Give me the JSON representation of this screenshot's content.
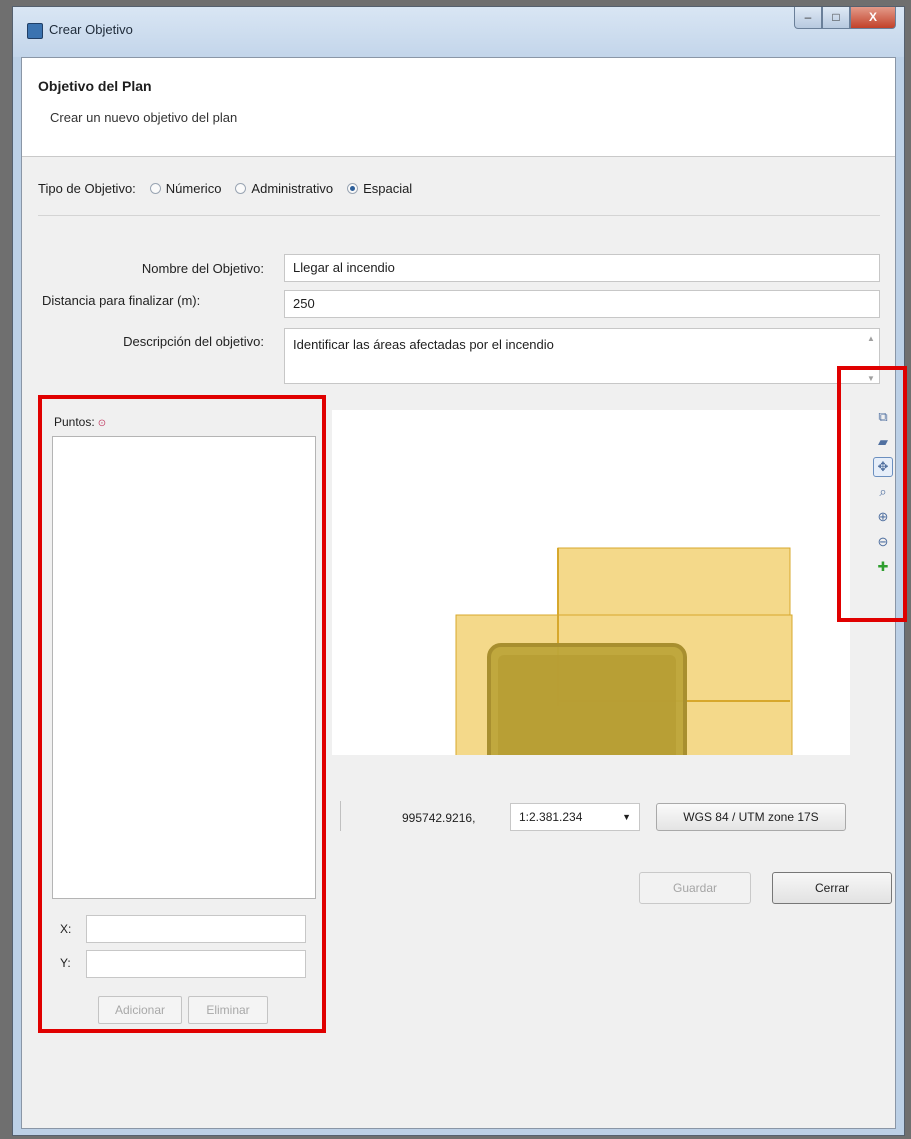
{
  "window": {
    "title": "Crear Objetivo",
    "controls": {
      "minimize": "–",
      "maximize": "□",
      "close": "X"
    }
  },
  "header": {
    "title": "Objetivo del Plan",
    "subtitle": "Crear un nuevo objetivo del plan"
  },
  "objective_type": {
    "label": "Tipo de Objetivo:",
    "options": [
      {
        "label": "Númerico",
        "checked": false
      },
      {
        "label": "Administrativo",
        "checked": false
      },
      {
        "label": "Espacial",
        "checked": true
      }
    ]
  },
  "form": {
    "name_label": "Nombre del Objetivo:",
    "name_value": "Llegar al incendio",
    "distance_label": "Distancia para finalizar (m):",
    "distance_value": "250",
    "description_label": "Descripción del objetivo:",
    "description_value": "Identificar las áreas afectadas por el incendio"
  },
  "points": {
    "label": "Puntos:",
    "required_marker": "⊙",
    "items": [],
    "x_label": "X:",
    "y_label": "Y:",
    "x_value": "",
    "y_value": "",
    "add_label": "Adicionar",
    "remove_label": "Eliminar"
  },
  "map_toolbar": {
    "tools": [
      {
        "icon": "layer-add-icon",
        "glyph": "⧉",
        "active": false
      },
      {
        "icon": "layer-icon",
        "glyph": "▰",
        "active": false
      },
      {
        "icon": "pan-icon",
        "glyph": "✥",
        "active": true
      },
      {
        "icon": "zoom-extent-icon",
        "glyph": "⌕",
        "active": false
      },
      {
        "icon": "zoom-in-icon",
        "glyph": "⊕",
        "active": false
      },
      {
        "icon": "zoom-out-icon",
        "glyph": "⊖",
        "active": false
      },
      {
        "icon": "add-point-icon",
        "glyph": "✚",
        "active": false
      }
    ]
  },
  "status": {
    "coordinate": "995742.9216,",
    "scale": "1:2.381.234",
    "crs": "WGS 84 / UTM zone 17S"
  },
  "buttons": {
    "save": "Guardar",
    "close": "Cerrar"
  },
  "colors": {
    "map_polygon_light": "#f4d98a",
    "map_polygon_dark": "#bda53a",
    "map_polygon_stroke": "#d7a82c",
    "highlight_box": "#e00000"
  }
}
